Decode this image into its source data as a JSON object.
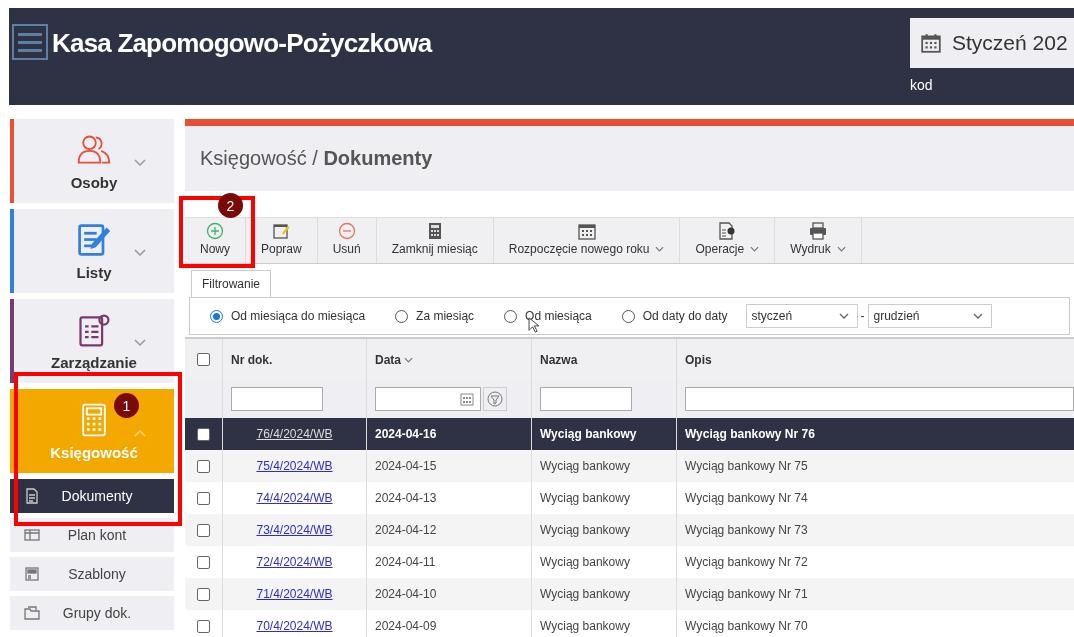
{
  "header": {
    "title": "Kasa Zapomogowo-Pożyczkowa",
    "period": "Styczeń 202",
    "code_label": "kod"
  },
  "sidebar": {
    "items": [
      {
        "label": "Osoby",
        "color": "#e94f35",
        "selected": false,
        "expanded": false
      },
      {
        "label": "Listy",
        "color": "#2f80e0",
        "selected": false,
        "expanded": false
      },
      {
        "label": "Zarządzanie",
        "color": "#7a3a6e",
        "selected": false,
        "expanded": false
      },
      {
        "label": "Księgowość",
        "color": "#f3a800",
        "selected": true,
        "expanded": true,
        "children": [
          {
            "label": "Dokumenty",
            "selected": true
          },
          {
            "label": "Plan kont",
            "selected": false
          },
          {
            "label": "Szablony",
            "selected": false
          },
          {
            "label": "Grupy dok.",
            "selected": false
          }
        ]
      }
    ]
  },
  "breadcrumb": {
    "parent": "Księgowość",
    "separator": "/",
    "current": "Dokumenty"
  },
  "toolbar": [
    {
      "label": "Nowy",
      "dropdown": false
    },
    {
      "label": "Popraw",
      "dropdown": false
    },
    {
      "label": "Usuń",
      "dropdown": false
    },
    {
      "label": "Zamknij miesiąc",
      "dropdown": false
    },
    {
      "label": "Rozpoczęcie nowego roku",
      "dropdown": true
    },
    {
      "label": "Operacje",
      "dropdown": true
    },
    {
      "label": "Wydruk",
      "dropdown": true
    }
  ],
  "filter": {
    "tab": "Filtrowanie",
    "options": [
      {
        "label": "Od miesiąca do miesiąca",
        "selected": true
      },
      {
        "label": "Za miesiąc",
        "selected": false
      },
      {
        "label": "Od miesiąca",
        "selected": false
      },
      {
        "label": "Od daty do daty",
        "selected": false
      }
    ],
    "from": "styczeń",
    "to": "grudzień",
    "separator": "-"
  },
  "table": {
    "all_checked": false,
    "columns": [
      {
        "label": "Nr dok.",
        "sortable": false
      },
      {
        "label": "Data",
        "sortable": true
      },
      {
        "label": "Nazwa",
        "sortable": false
      },
      {
        "label": "Opis",
        "sortable": false
      }
    ],
    "rows": [
      {
        "number": "76/4/2024/WB",
        "date": "2024-04-16",
        "name": "Wyciąg bankowy",
        "description": "Wyciąg bankowy Nr 76",
        "selected": true,
        "checked": false
      },
      {
        "number": "75/4/2024/WB",
        "date": "2024-04-15",
        "name": "Wyciąg bankowy",
        "description": "Wyciąg bankowy Nr 75",
        "selected": false,
        "checked": false
      },
      {
        "number": "74/4/2024/WB",
        "date": "2024-04-13",
        "name": "Wyciąg bankowy",
        "description": "Wyciąg bankowy Nr 74",
        "selected": false,
        "checked": false
      },
      {
        "number": "73/4/2024/WB",
        "date": "2024-04-12",
        "name": "Wyciąg bankowy",
        "description": "Wyciąg bankowy Nr 73",
        "selected": false,
        "checked": false
      },
      {
        "number": "72/4/2024/WB",
        "date": "2024-04-11",
        "name": "Wyciąg bankowy",
        "description": "Wyciąg bankowy Nr 72",
        "selected": false,
        "checked": false
      },
      {
        "number": "71/4/2024/WB",
        "date": "2024-04-10",
        "name": "Wyciąg bankowy",
        "description": "Wyciąg bankowy Nr 71",
        "selected": false,
        "checked": false
      },
      {
        "number": "70/4/2024/WB",
        "date": "2024-04-09",
        "name": "Wyciąg bankowy",
        "description": "Wyciąg bankowy Nr 70",
        "selected": false,
        "checked": false
      }
    ]
  },
  "annotations": [
    {
      "label": "1"
    },
    {
      "label": "2"
    }
  ]
}
